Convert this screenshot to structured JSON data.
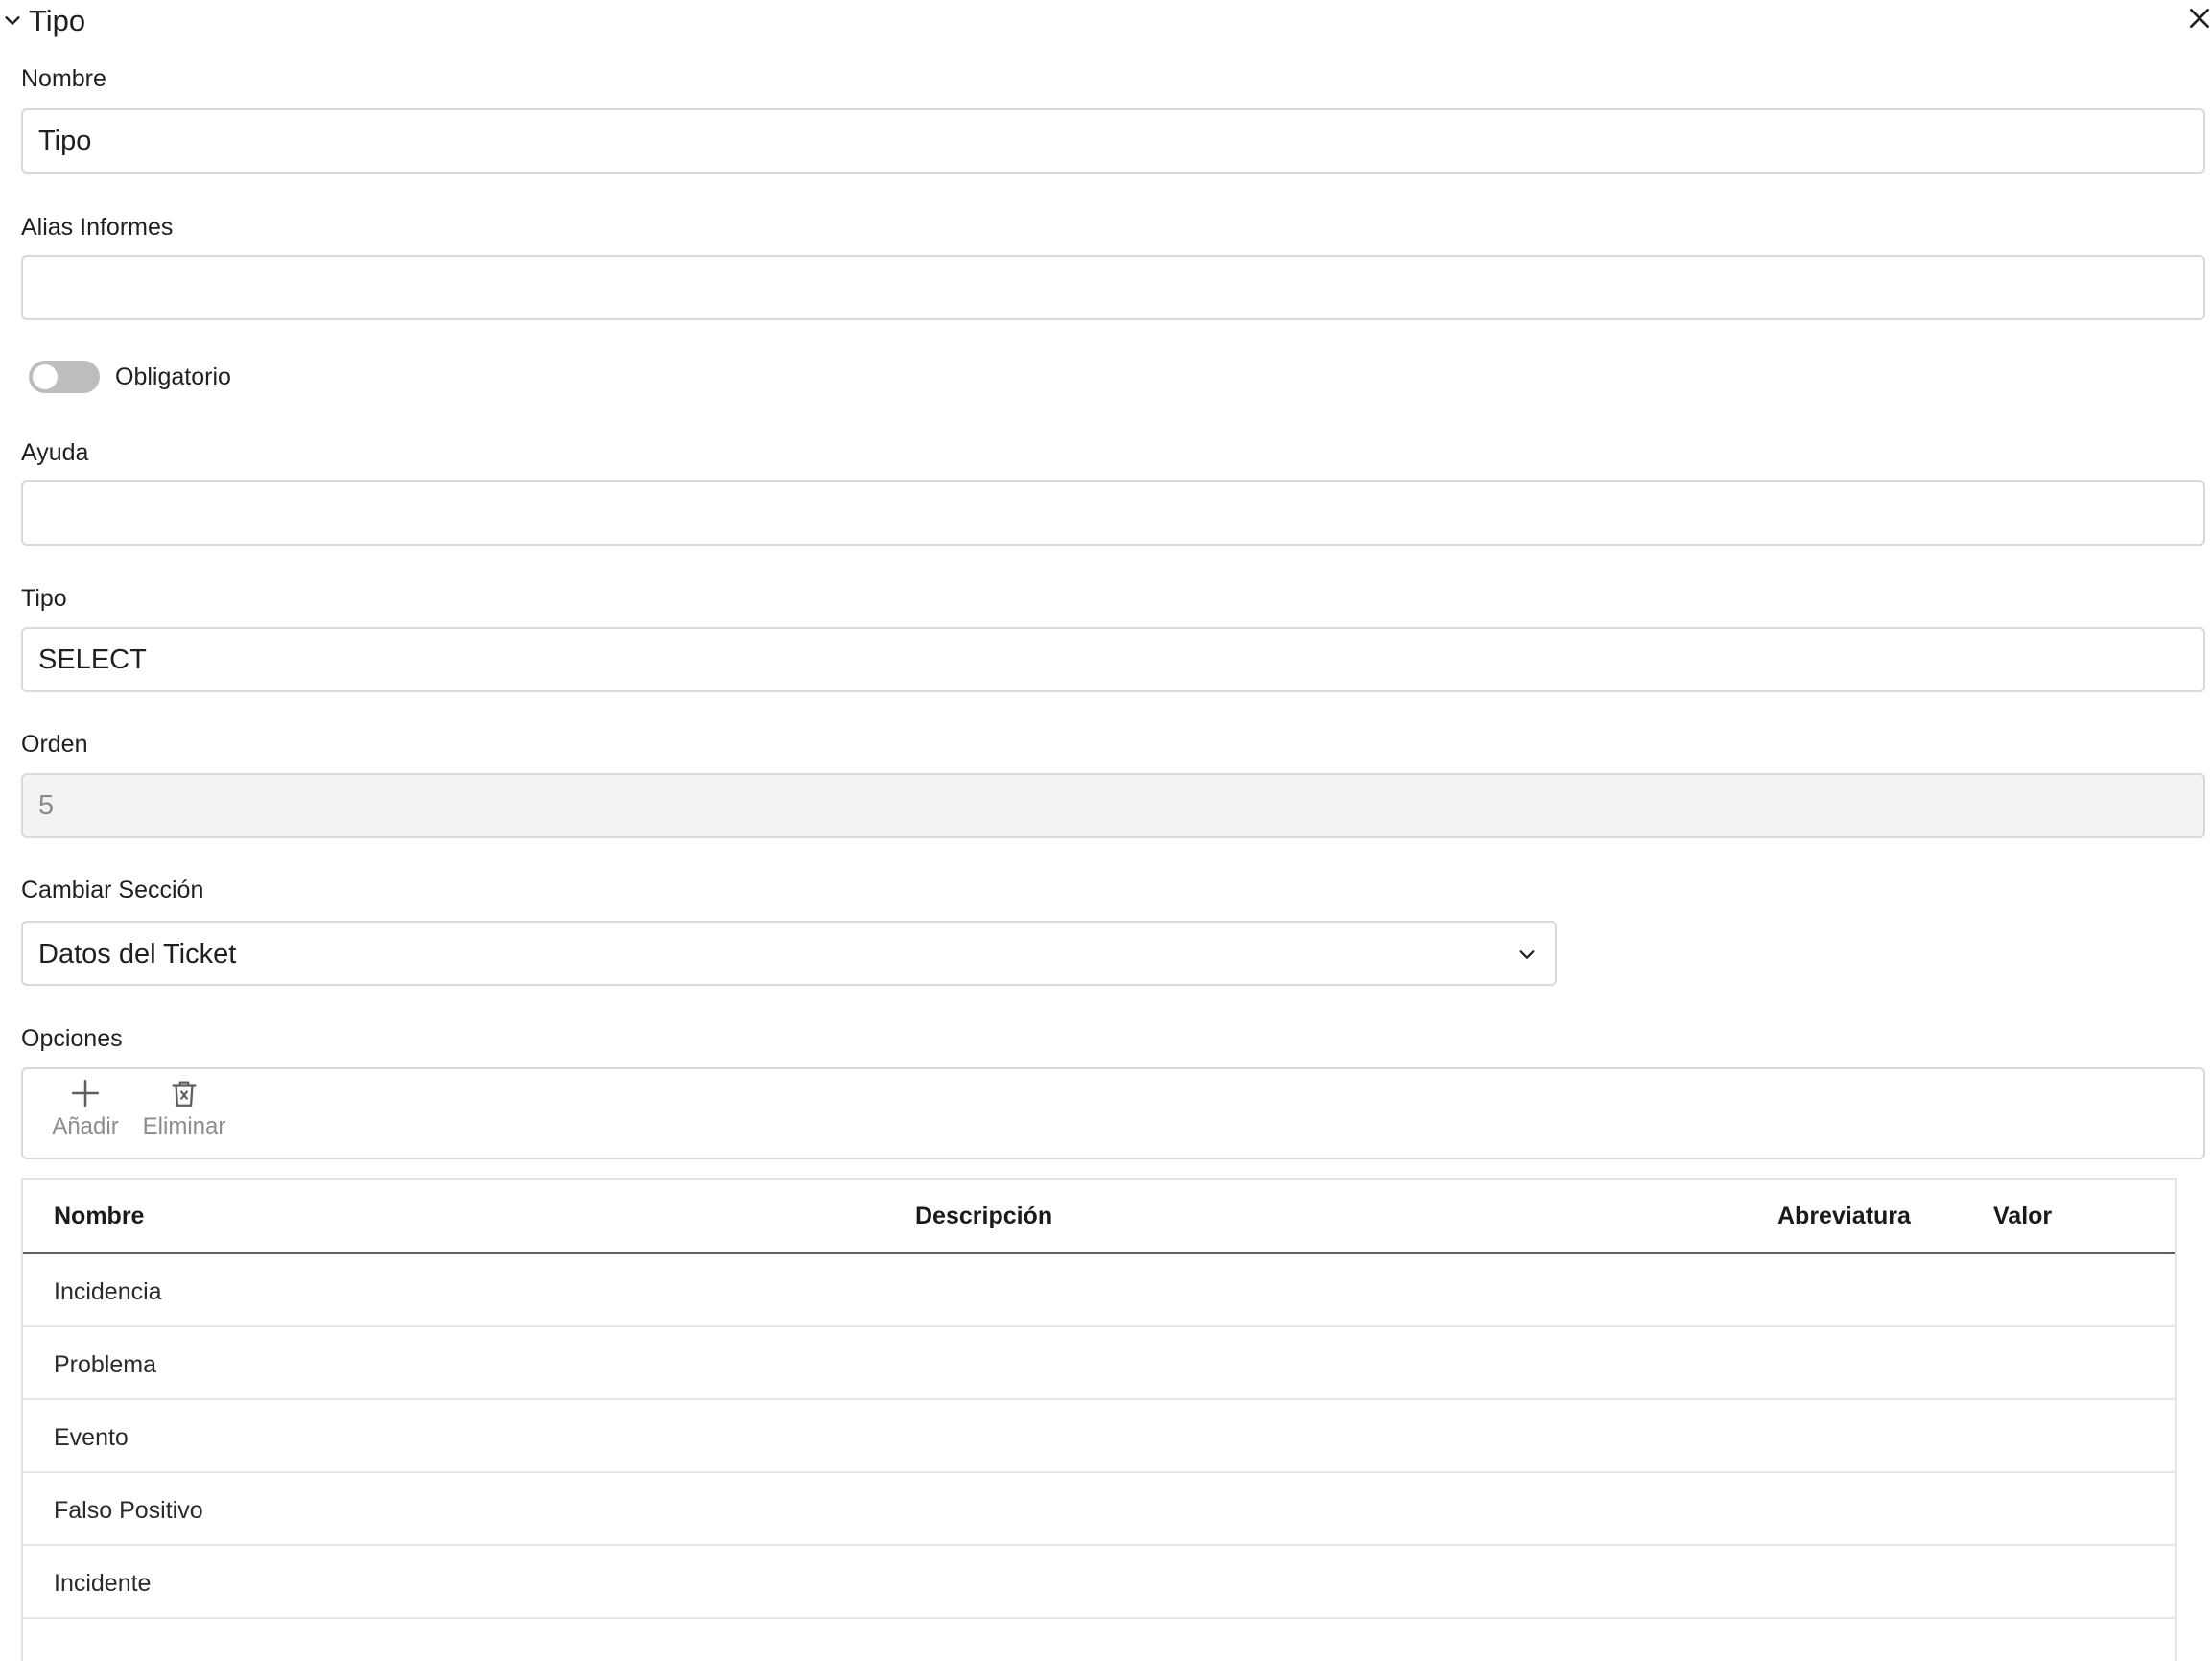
{
  "panel": {
    "title": "Tipo"
  },
  "form": {
    "nombre": {
      "label": "Nombre",
      "value": "Tipo"
    },
    "alias": {
      "label": "Alias Informes",
      "value": ""
    },
    "obligatorio": {
      "label": "Obligatorio",
      "checked": false
    },
    "ayuda": {
      "label": "Ayuda",
      "value": ""
    },
    "tipo": {
      "label": "Tipo",
      "value": "SELECT"
    },
    "orden": {
      "label": "Orden",
      "value": "5"
    },
    "seccion": {
      "label": "Cambiar Sección",
      "selected": "Datos del Ticket"
    }
  },
  "opciones": {
    "label": "Opciones",
    "toolbar": {
      "add_label": "Añadir",
      "delete_label": "Eliminar"
    },
    "columns": {
      "nombre": "Nombre",
      "descripcion": "Descripción",
      "abreviatura": "Abreviatura",
      "valor": "Valor"
    },
    "rows": [
      {
        "nombre": "Incidencia"
      },
      {
        "nombre": "Problema"
      },
      {
        "nombre": "Evento"
      },
      {
        "nombre": "Falso Positivo"
      },
      {
        "nombre": "Incidente"
      }
    ]
  },
  "colors": {
    "border": "#d9d9d9",
    "toggle_off": "#bdbdbd",
    "disabled_bg": "#f3f3f3",
    "header_rule": "#5c5f72",
    "muted_text": "#8c8c8c"
  },
  "icons": {
    "collapse": "chevron-down-icon",
    "close": "close-icon",
    "select": "chevron-down-icon",
    "add": "plus-icon",
    "delete": "trash-icon"
  }
}
